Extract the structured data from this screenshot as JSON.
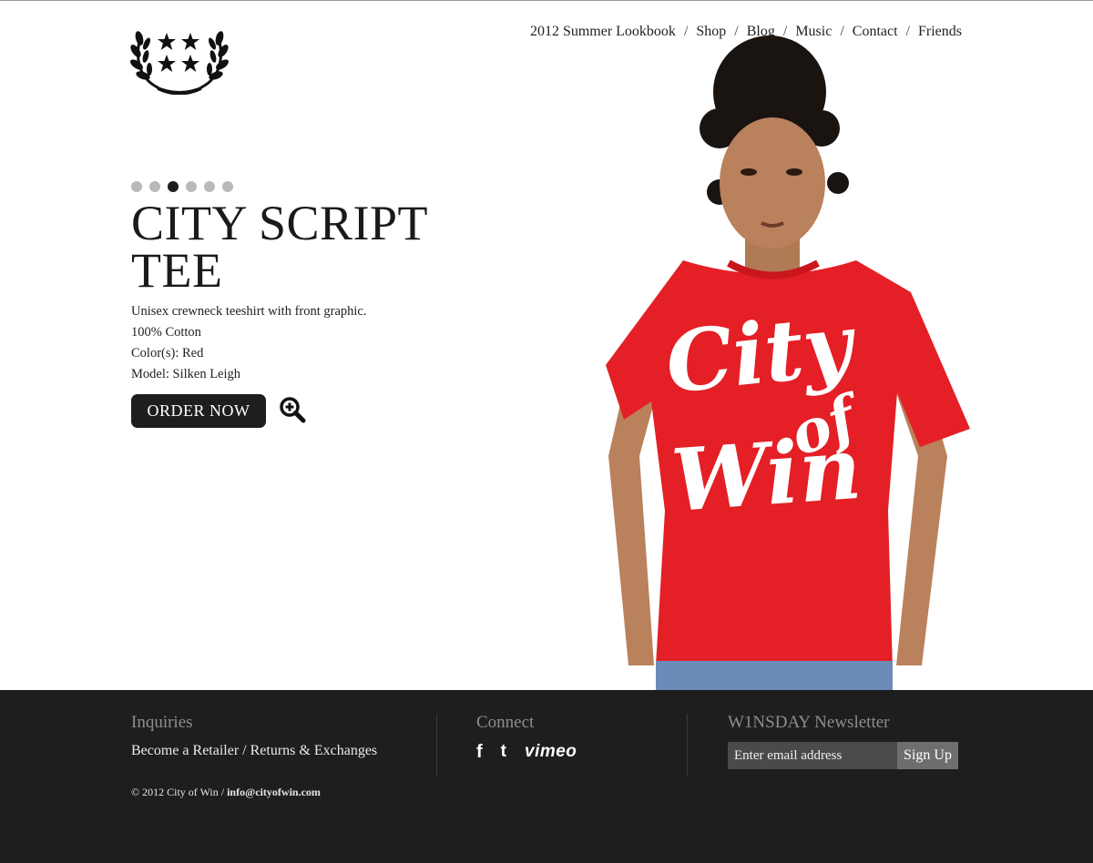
{
  "nav": {
    "items": [
      {
        "label": "2012 Summer Lookbook"
      },
      {
        "label": "Shop"
      },
      {
        "label": "Blog"
      },
      {
        "label": "Music"
      },
      {
        "label": "Contact"
      },
      {
        "label": "Friends"
      }
    ],
    "separator": "/"
  },
  "slider": {
    "count": 6,
    "active_index": 2
  },
  "product": {
    "title": "CITY SCRIPT TEE",
    "details": [
      "Unisex crewneck teeshirt with front graphic.",
      "100% Cotton",
      "Color(s): Red",
      "Model: Silken Leigh"
    ],
    "order_label": "ORDER NOW",
    "shirt_graphic": [
      "City",
      "of",
      "Win"
    ],
    "shirt_color": "#e41f26"
  },
  "footer": {
    "inquiries": {
      "heading": "Inquiries",
      "link1": "Become a Retailer",
      "sep": " / ",
      "link2": "Returns & Exchanges"
    },
    "connect": {
      "heading": "Connect",
      "facebook": "f",
      "twitter": "t",
      "vimeo": "vimeo"
    },
    "newsletter": {
      "heading": "W1NSDAY Newsletter",
      "placeholder": "Enter email address",
      "button": "Sign Up"
    },
    "copyright": "© 2012 City of Win / ",
    "email": "info@cityofwin.com"
  },
  "colors": {
    "footer_bg": "#1e1e1e",
    "accent_red": "#e41f26",
    "dark": "#1e1e1e"
  }
}
